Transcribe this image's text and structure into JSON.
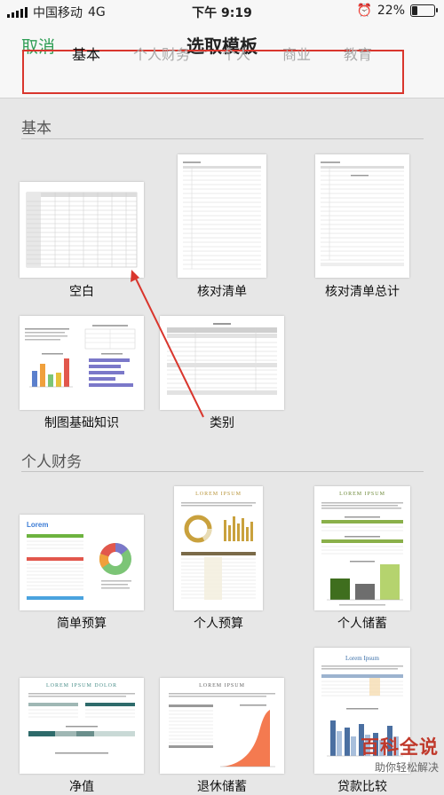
{
  "status_bar": {
    "carrier": "中国移动",
    "network": "4G",
    "time": "下午 9:19",
    "battery": "22%",
    "alarm_icon": "alarm-icon"
  },
  "nav": {
    "cancel": "取消",
    "title": "选取模板",
    "tabs": [
      {
        "label": "基本",
        "active": true
      },
      {
        "label": "个人财务",
        "active": false
      },
      {
        "label": "个人",
        "active": false
      },
      {
        "label": "商业",
        "active": false
      },
      {
        "label": "教育",
        "active": false
      }
    ]
  },
  "sections": [
    {
      "title": "基本",
      "templates": [
        "空白",
        "核对清单",
        "核对清单总计",
        "制图基础知识",
        "类别"
      ]
    },
    {
      "title": "个人财务",
      "templates": [
        "简单预算",
        "个人预算",
        "个人储蓄",
        "净值",
        "退休储蓄",
        "贷款比较"
      ]
    }
  ],
  "thumbnails": {
    "lorem": "Lorem",
    "lorem_ipsum": "LOREM IPSUM",
    "lorem_ipsum_dolor": "LOREM IPSUM DOLOR",
    "lorem_ipsum_title": "Lorem Ipsum"
  },
  "watermark": {
    "main": "百科全说",
    "sub": "助你轻松解决"
  },
  "colors": {
    "accent": "#2f9e56",
    "highlight_box": "#d9362d",
    "annotation_arrow": "#d9362d"
  }
}
